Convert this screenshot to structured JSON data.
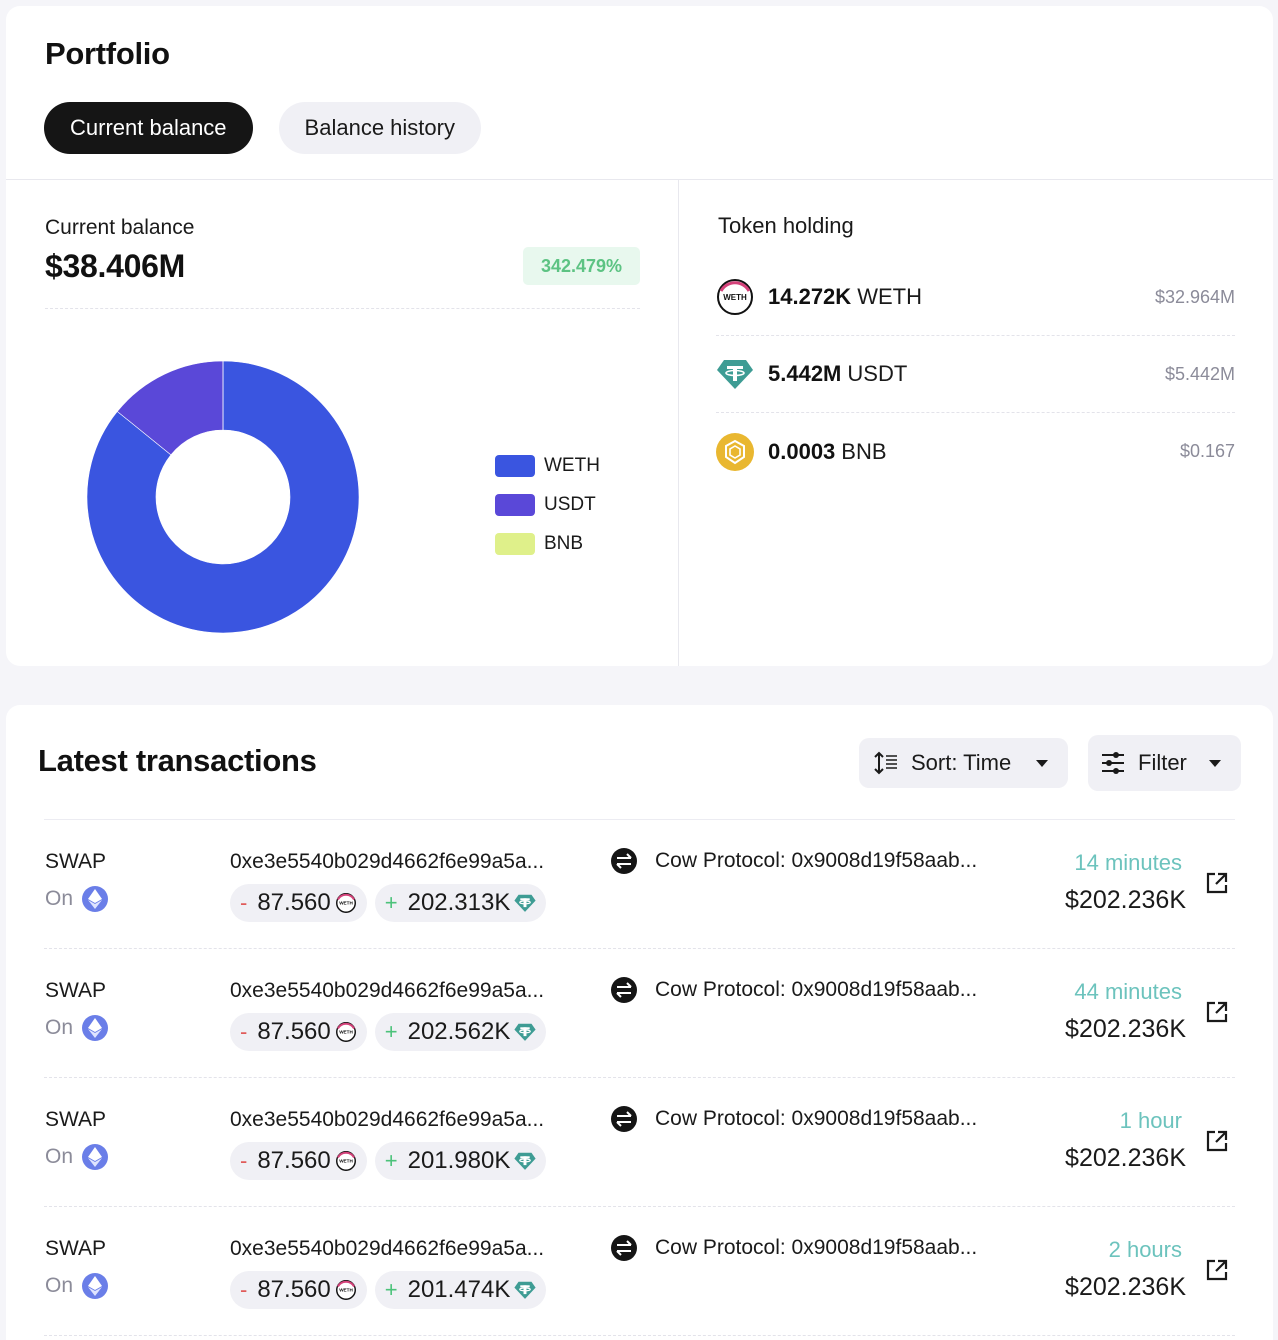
{
  "portfolio": {
    "title": "Portfolio",
    "tabs": [
      {
        "label": "Current balance",
        "active": true
      },
      {
        "label": "Balance history",
        "active": false
      }
    ],
    "balance_label": "Current balance",
    "balance_value": "$38.406M",
    "change_pct": "342.479%",
    "token_holding_title": "Token holding",
    "holdings": [
      {
        "amount": "14.272K",
        "symbol": "WETH",
        "usd": "$32.964M",
        "icon": "weth-icon"
      },
      {
        "amount": "5.442M",
        "symbol": "USDT",
        "usd": "$5.442M",
        "icon": "usdt-icon"
      },
      {
        "amount": "0.0003",
        "symbol": "BNB",
        "usd": "$0.167",
        "icon": "bnb-icon"
      }
    ]
  },
  "chart_data": {
    "type": "pie",
    "title": "",
    "donut": true,
    "legend_position": "right",
    "categories": [
      "WETH",
      "USDT",
      "BNB"
    ],
    "values": [
      32.964,
      5.442,
      1.67e-07
    ],
    "units": "USD millions",
    "colors": [
      "#3a55e0",
      "#5a48d8",
      "#dff08a"
    ]
  },
  "transactions": {
    "title": "Latest transactions",
    "sort_label": "Sort: Time",
    "filter_label": "Filter",
    "rows": [
      {
        "type": "SWAP",
        "on_label": "On",
        "hash": "0xe3e5540b029d4662f6e99a5a...",
        "out_amount": "87.560",
        "in_amount": "202.313K",
        "counterparty": "Cow Protocol: 0x9008d19f58aab...",
        "time": "14 minutes",
        "usd": "$202.236K"
      },
      {
        "type": "SWAP",
        "on_label": "On",
        "hash": "0xe3e5540b029d4662f6e99a5a...",
        "out_amount": "87.560",
        "in_amount": "202.562K",
        "counterparty": "Cow Protocol: 0x9008d19f58aab...",
        "time": "44 minutes",
        "usd": "$202.236K"
      },
      {
        "type": "SWAP",
        "on_label": "On",
        "hash": "0xe3e5540b029d4662f6e99a5a...",
        "out_amount": "87.560",
        "in_amount": "201.980K",
        "counterparty": "Cow Protocol: 0x9008d19f58aab...",
        "time": "1 hour",
        "usd": "$202.236K"
      },
      {
        "type": "SWAP",
        "on_label": "On",
        "hash": "0xe3e5540b029d4662f6e99a5a...",
        "out_amount": "87.560",
        "in_amount": "201.474K",
        "counterparty": "Cow Protocol: 0x9008d19f58aab...",
        "time": "2 hours",
        "usd": "$202.236K"
      }
    ],
    "out_sign": "-",
    "in_sign": "+"
  }
}
